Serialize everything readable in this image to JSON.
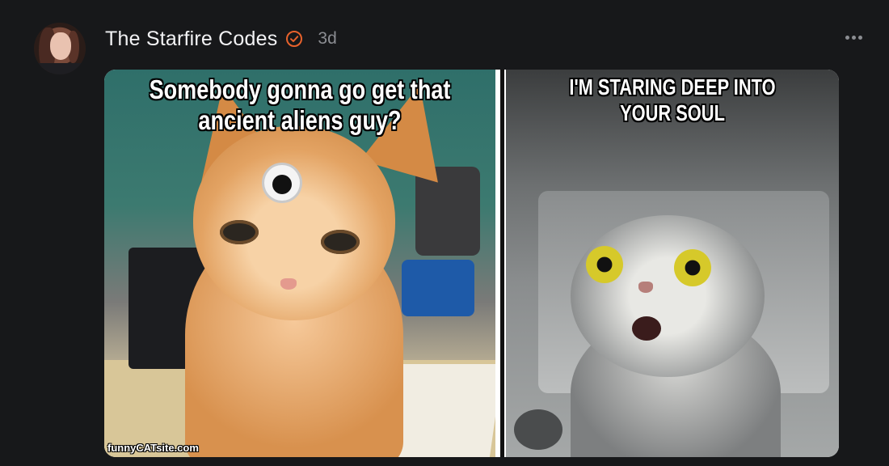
{
  "post": {
    "author": "The Starfire Codes",
    "time": "3d",
    "verified_color": "#e8622c",
    "more_icon": "more-horizontal-icon"
  },
  "media": {
    "left_caption": "Somebody gonna go get that ancient aliens guy?",
    "right_caption": "I'M STARING DEEP INTO YOUR SOUL",
    "watermark": "funnyCATsite.com"
  }
}
